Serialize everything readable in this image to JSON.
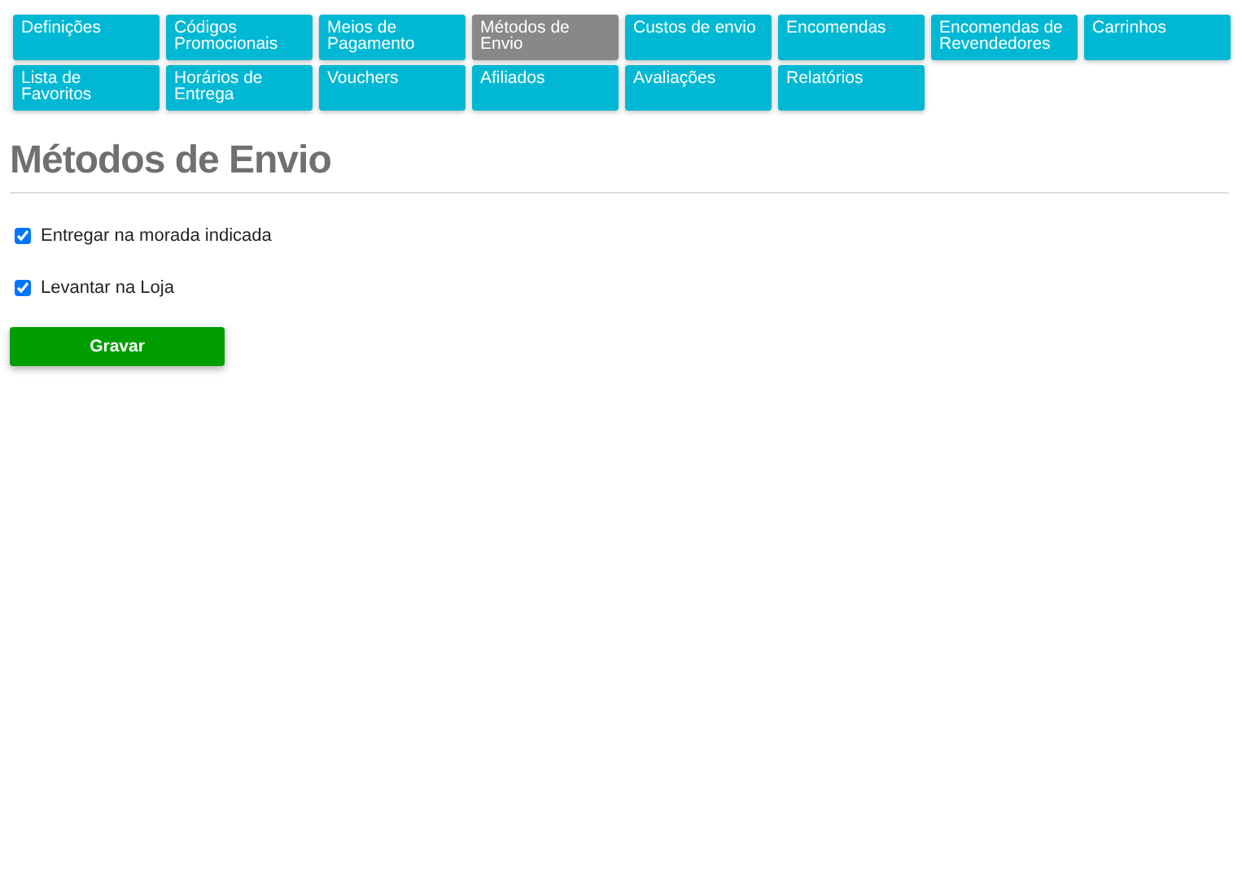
{
  "tabs": [
    {
      "label": "Definições",
      "selected": false
    },
    {
      "label": "Códigos Promocionais",
      "selected": false
    },
    {
      "label": "Meios de Pagamento",
      "selected": false
    },
    {
      "label": "Métodos de Envio",
      "selected": true
    },
    {
      "label": "Custos de envio",
      "selected": false
    },
    {
      "label": "Encomendas",
      "selected": false
    },
    {
      "label": "Encomendas de Revendedores",
      "selected": false
    },
    {
      "label": "Carrinhos",
      "selected": false
    },
    {
      "label": "Lista de Favoritos",
      "selected": false
    },
    {
      "label": "Horários de Entrega",
      "selected": false
    },
    {
      "label": "Vouchers",
      "selected": false
    },
    {
      "label": "Afiliados",
      "selected": false
    },
    {
      "label": "Avaliações",
      "selected": false
    },
    {
      "label": "Relatórios",
      "selected": false
    }
  ],
  "heading": "Métodos de Envio",
  "options": [
    {
      "label": "Entregar na morada indicada",
      "checked": true
    },
    {
      "label": "Levantar na Loja",
      "checked": true
    }
  ],
  "save_button": "Gravar"
}
